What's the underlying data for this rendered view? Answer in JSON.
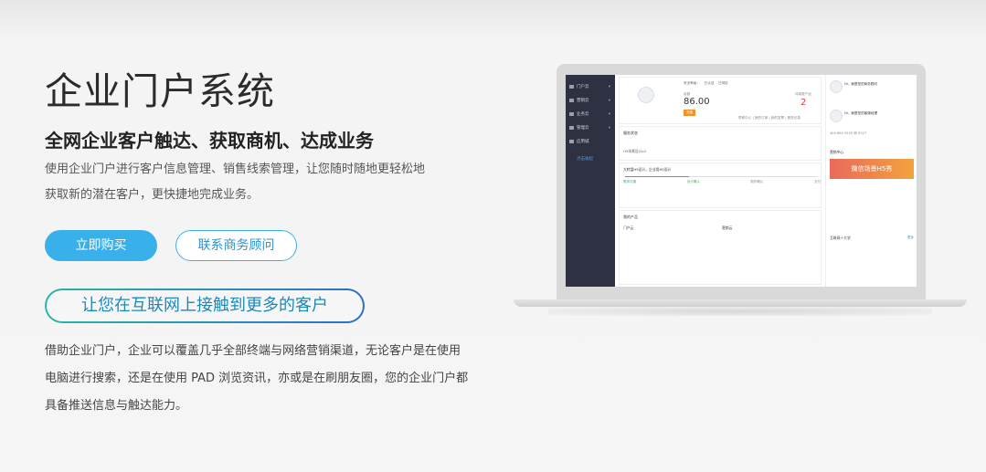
{
  "hero": {
    "title": "企业门户系统",
    "subtitle": "全网企业客户触达、获取商机、达成业务",
    "desc_line1": "使用企业门户进行客户信息管理、销售线索管理，让您随时随地更轻松地",
    "desc_line2": "获取新的潜在客户，更快捷地完成业务。",
    "buy_label": "立即购买",
    "consult_label": "联系商务顾问"
  },
  "section": {
    "pill_label": "让您在互联网上接触到更多的客户",
    "body_line1": "借助企业门户，企业可以覆盖几乎全部终端与网络营销渠道，无论客户是在使用",
    "body_line2": "电脑进行搜索，还是在使用 PAD 浏览资讯，亦或是在刷朋友圈，您的企业门户都",
    "body_line3": "具备推送信息与触达能力。"
  },
  "colors": {
    "accent": "#3ab0ea",
    "pill_gradient_start": "#29b5a4",
    "pill_gradient_end": "#2d6ec9",
    "sidebar": "#2d3142"
  },
  "mockup": {
    "sidebar": [
      {
        "label": "门户云"
      },
      {
        "label": "营销云"
      },
      {
        "label": "业务云"
      },
      {
        "label": "管理云"
      },
      {
        "label": "应用城"
      }
    ],
    "sidebar_fold": "点击收起",
    "security_items": [
      "安全等级：",
      "已认证",
      "已绑定"
    ],
    "balance_label": "余额",
    "balance_value": "86.00",
    "recharge": "充值",
    "product_count_label": "待续费产品",
    "product_count": "2",
    "links": "帮助中心 | 我的订单 | 我的发票 | 服务记录",
    "service_title": "服务状态",
    "service_expiring": "H5场景设计x2",
    "progress_title": "大转盘H5设计，企业用H5设计",
    "progress_steps": [
      "需求沟通",
      "设计确认",
      "制作确认",
      "交付"
    ],
    "my_products": "我的产品",
    "product_groups": [
      "门户云",
      "营销云"
    ],
    "marketing_center": "营销中心",
    "banner_text": "微信场景H5秀",
    "internet_plus": "互联网＋大学",
    "more": "更多",
    "consultant1": "Hi，我是您的商务顾问",
    "consultant2": "Hi，我是您的客服经理",
    "phone": "400 860 5555 转 9527"
  }
}
